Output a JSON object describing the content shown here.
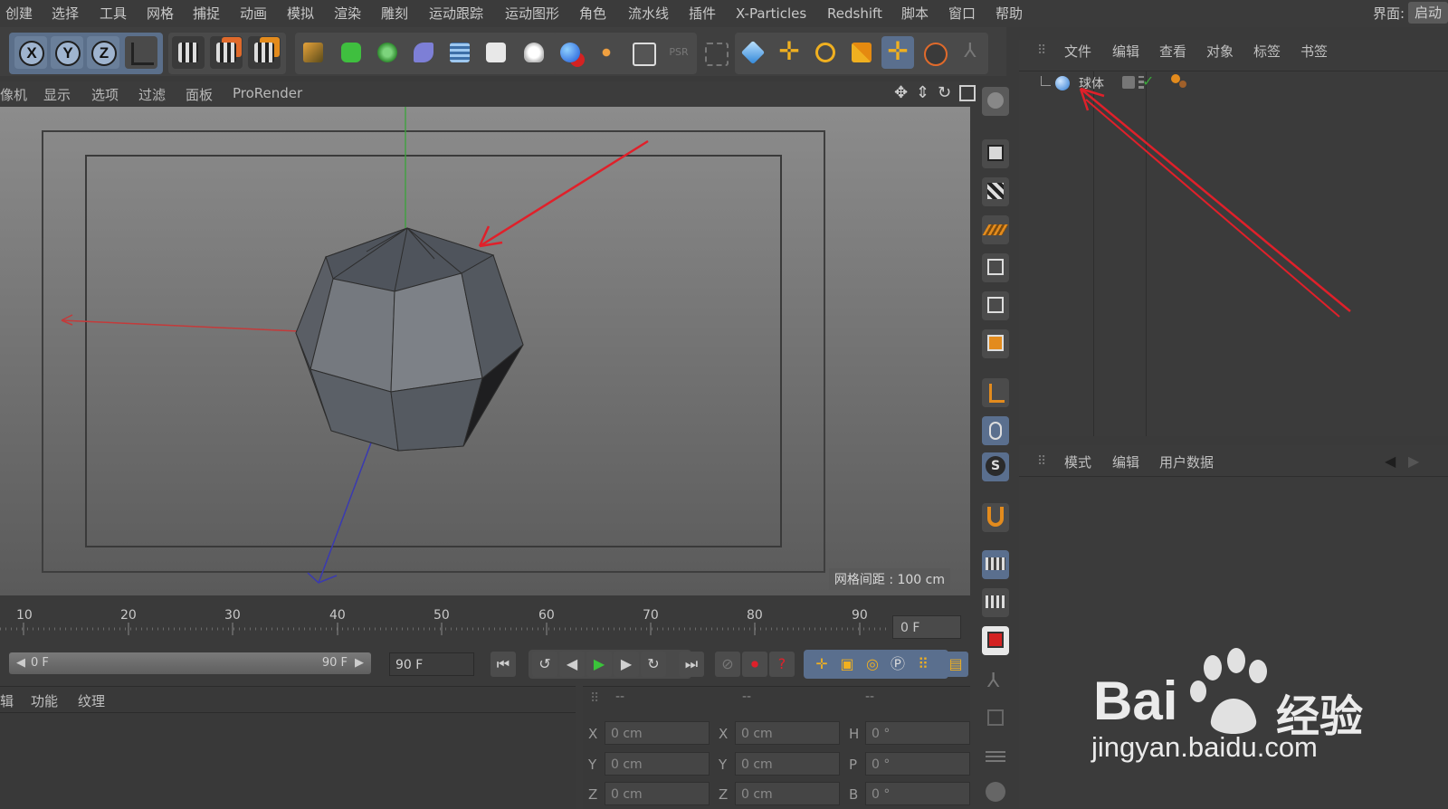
{
  "menubar": {
    "items": [
      "创建",
      "选择",
      "工具",
      "网格",
      "捕捉",
      "动画",
      "模拟",
      "渲染",
      "雕刻",
      "运动跟踪",
      "运动图形",
      "角色",
      "流水线",
      "插件",
      "X-Particles",
      "Redshift",
      "脚本",
      "窗口",
      "帮助"
    ],
    "ui_label": "界面:",
    "ui_value": "启动"
  },
  "toolbar": {
    "axis_buttons": [
      "X",
      "Y",
      "Z"
    ],
    "icons": [
      "coordinate-system-icon",
      "render-view-icon",
      "render-picture-viewer-icon",
      "render-settings-icon",
      "pen-icon",
      "cube-object-icon",
      "cloner-icon",
      "deformer-icon",
      "floor-icon",
      "camera-icon",
      "light-icon",
      "material-icon",
      "effector-icon",
      "xpresso-icon",
      "psr-icon",
      "snap-icon",
      "model-mode-icon",
      "move-icon",
      "rotate-icon",
      "scale-icon",
      "live-select-icon",
      "selection-icon",
      "extra-icon"
    ],
    "psr_label": "PSR"
  },
  "viewport": {
    "menu": [
      "像机",
      "显示",
      "选项",
      "过滤",
      "面板",
      "ProRender"
    ],
    "grid_label": "网格间距 : 100 cm"
  },
  "object_manager": {
    "menu": [
      "文件",
      "编辑",
      "查看",
      "对象",
      "标签",
      "书签"
    ],
    "objects": [
      {
        "name": "球体"
      }
    ]
  },
  "attribute_manager": {
    "menu": [
      "模式",
      "编辑",
      "用户数据"
    ]
  },
  "timeline": {
    "ticks": [
      "10",
      "20",
      "30",
      "40",
      "50",
      "60",
      "70",
      "80",
      "90"
    ],
    "current_frame": "0 F",
    "range_start": "0 F",
    "range_end": "90 F",
    "end_frame": "90 F"
  },
  "material_panel": {
    "menu": [
      "辑",
      "功能",
      "纹理"
    ]
  },
  "coordinates": {
    "headers": [
      "--",
      "--",
      "--"
    ],
    "rows": [
      {
        "axis1": "X",
        "val1": "0 cm",
        "axis2": "X",
        "val2": "0 cm",
        "axis3": "H",
        "val3": "0 °"
      },
      {
        "axis1": "Y",
        "val1": "0 cm",
        "axis2": "Y",
        "val2": "0 cm",
        "axis3": "P",
        "val3": "0 °"
      },
      {
        "axis1": "Z",
        "val1": "0 cm",
        "axis2": "Z",
        "val2": "0 cm",
        "axis3": "B",
        "val3": "0 °"
      }
    ]
  },
  "watermark": {
    "brand_left": "Bai",
    "brand_right": "经验",
    "url": "jingyan.baidu.com"
  },
  "colors": {
    "annotation_arrow": "#e0202a",
    "accent_orange": "#e38b1d",
    "axis_x": "#c43a3a",
    "axis_y": "#3aa43a",
    "axis_z": "#3a3ab0"
  }
}
